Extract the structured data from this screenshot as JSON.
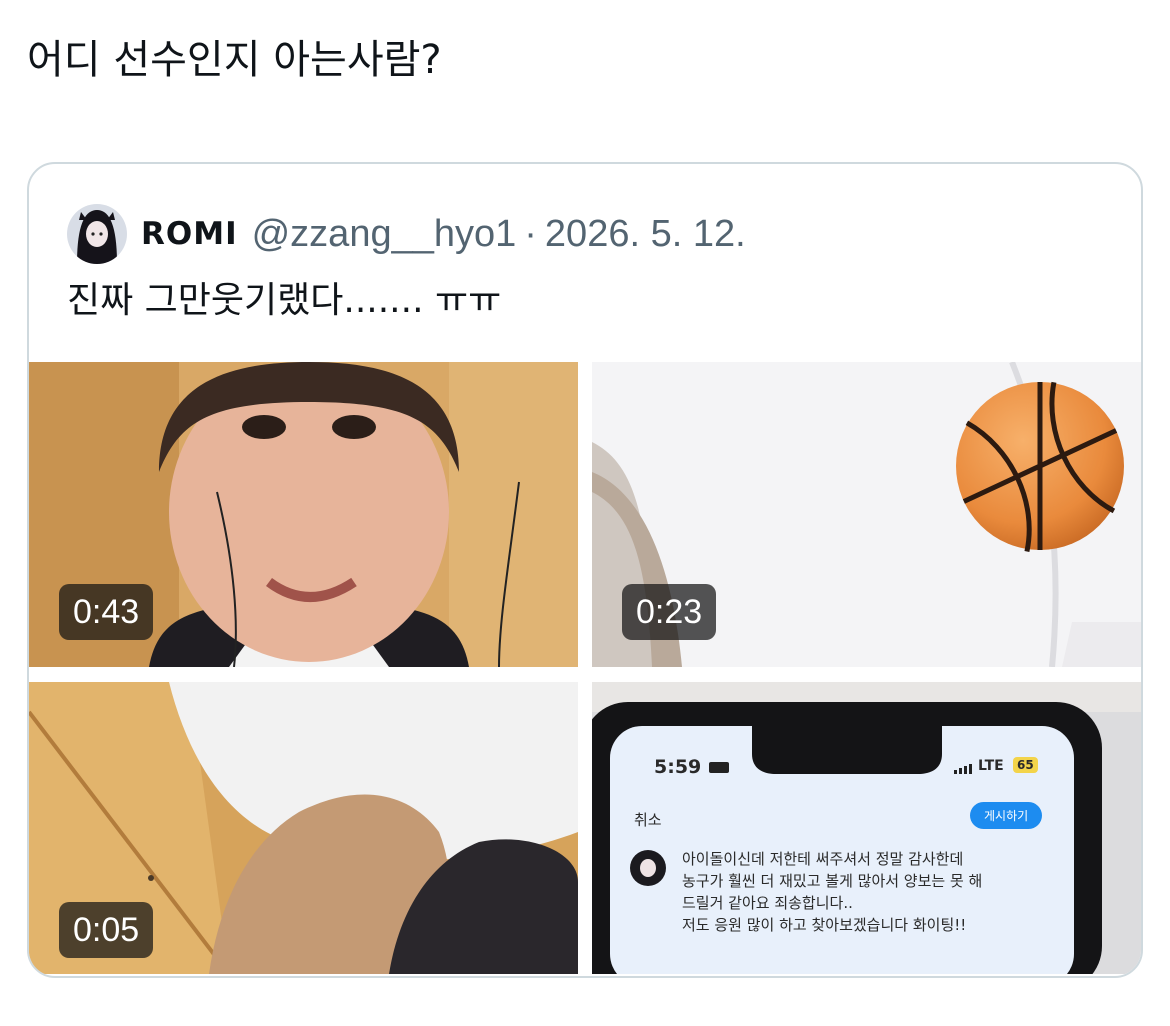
{
  "post": {
    "text": "어디 선수인지 아는사람?"
  },
  "quote": {
    "display_name": "ROMI",
    "handle": "@zzang__hyo1",
    "separator": "·",
    "date": "2026. 5. 12.",
    "text": "진짜 그만웃기랬다....... ㅠㅠ"
  },
  "media": [
    {
      "duration": "0:43"
    },
    {
      "duration": "0:23"
    },
    {
      "duration": "0:05"
    },
    {
      "phone": {
        "time": "5:59",
        "network": "LTE",
        "battery": "65",
        "cancel_label": "취소",
        "post_button_label": "게시하기",
        "message_lines": [
          "아이돌이신데 저한테 써주셔서 정말 감사한데",
          "농구가 훨씬 더 재밌고 볼게 많아서 양보는 못 해",
          "드릴거 같아요 죄송합니다..",
          "저도 응원 많이 하고 찾아보겠습니다 화이팅!!"
        ]
      }
    }
  ],
  "colors": {
    "text_primary": "#0f1419",
    "text_secondary": "#536471",
    "card_border": "#cfd9de",
    "phone_accent": "#1d8cf0"
  }
}
